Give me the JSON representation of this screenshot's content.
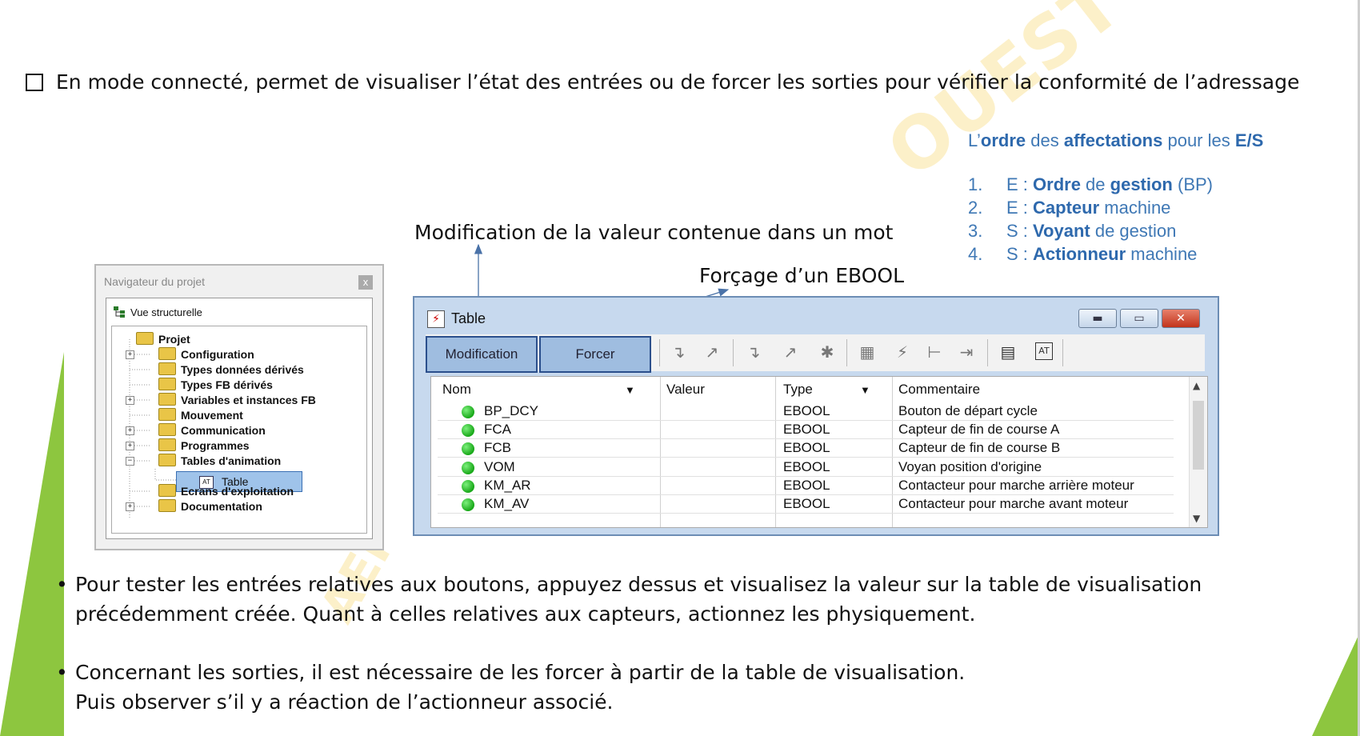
{
  "heading": "En mode connecté, permet de visualiser l’état des entrées ou de forcer les sorties pour vérifier la conformité de l’adressage",
  "watermark": [
    "AEI",
    "OUEST"
  ],
  "callouts": {
    "modification": "Modification de la valeur contenue dans un mot",
    "forcage": "Forçage d’un EBOOL"
  },
  "order": {
    "title": {
      "p1": "L’",
      "p2": "ordre",
      "p3": " des ",
      "p4": "affectations",
      "p5": " pour les ",
      "p6": "E/S"
    },
    "items": [
      {
        "num": "1.",
        "pre": "E : ",
        "b1": "Ordre",
        "mid": " de ",
        "b2": "gestion",
        "post": " (BP)"
      },
      {
        "num": "2.",
        "pre": "E : ",
        "b1": "Capteur",
        "mid": " machine",
        "b2": "",
        "post": ""
      },
      {
        "num": "3.",
        "pre": "S : ",
        "b1": "Voyant",
        "mid": "  de gestion",
        "b2": "",
        "post": ""
      },
      {
        "num": "4.",
        "pre": "S : ",
        "b1": "Actionneur",
        "mid": " machine",
        "b2": "",
        "post": ""
      }
    ]
  },
  "navigator": {
    "title": "Navigateur du projet",
    "close": "x",
    "view": "Vue structurelle",
    "tree": [
      "Projet",
      "Configuration",
      "Types données dérivés",
      "Types FB dérivés",
      "Variables et instances FB",
      "Mouvement",
      "Communication",
      "Programmes",
      "Tables d'animation",
      "Table",
      "Ecrans d'exploitation",
      "Documentation"
    ],
    "at_label": "AT"
  },
  "table_window": {
    "title": "Table",
    "buttons": {
      "modification": "Modification",
      "forcer": "Forcer"
    },
    "columns": {
      "nom": "Nom",
      "valeur": "Valeur",
      "type": "Type",
      "commentaire": "Commentaire"
    },
    "rows": [
      {
        "nom": "BP_DCY",
        "valeur": "",
        "type": "EBOOL",
        "commentaire": "Bouton de départ cycle"
      },
      {
        "nom": "FCA",
        "valeur": "",
        "type": "EBOOL",
        "commentaire": "Capteur de fin de course A"
      },
      {
        "nom": "FCB",
        "valeur": "",
        "type": "EBOOL",
        "commentaire": "Capteur de fin de course B"
      },
      {
        "nom": "VOM",
        "valeur": "",
        "type": "EBOOL",
        "commentaire": "Voyan position d'origine"
      },
      {
        "nom": "KM_AR",
        "valeur": "",
        "type": "EBOOL",
        "commentaire": "Contacteur pour marche arrière moteur"
      },
      {
        "nom": "KM_AV",
        "valeur": "",
        "type": "EBOOL",
        "commentaire": "Contacteur pour marche avant moteur"
      }
    ],
    "accent": "#2b4f8c"
  },
  "bullets": [
    {
      "line1": "Pour tester les entrées relatives aux boutons, appuyez dessus et visualisez la valeur sur la table de visualisation",
      "line2": "précédemment créée. Quant à celles relatives aux capteurs, actionnez les physiquement."
    },
    {
      "line1": "Concernant les sorties, il est nécessaire de les forcer à partir de la table de visualisation.",
      "line2": "Puis observer s’il y a réaction de l’actionneur associé."
    }
  ],
  "colors": {
    "green": "#8dc63f",
    "blue_text": "#3f78b5"
  }
}
